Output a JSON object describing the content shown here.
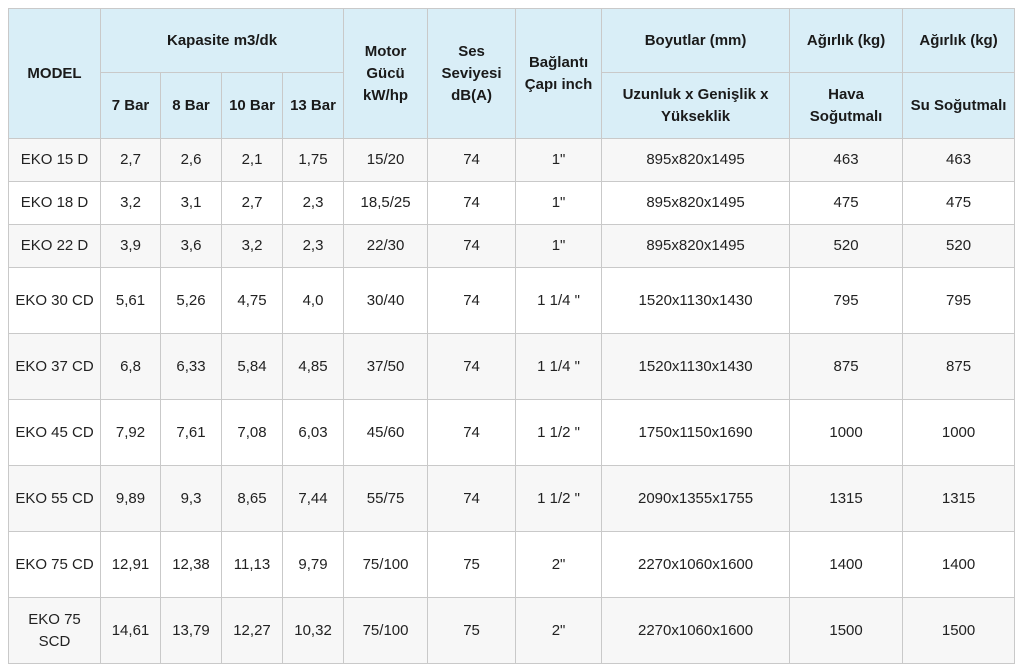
{
  "header": {
    "model": "MODEL",
    "capacity": "Kapasite m3/dk",
    "pressures": [
      "7 Bar",
      "8 Bar",
      "10 Bar",
      "13 Bar"
    ],
    "motor": "Motor Gücü kW/hp",
    "sound": "Ses Seviyesi dB(A)",
    "connection": "Bağlantı Çapı inch",
    "dimensions": "Boyutlar (mm)",
    "dimensions_sub": "Uzunluk x Genişlik x Yükseklik",
    "weight_air": "Ağırlık (kg)",
    "weight_air_sub": "Hava Soğutmalı",
    "weight_water": "Ağırlık (kg)",
    "weight_water_sub": "Su Soğutmalı"
  },
  "rows": [
    {
      "model": "EKO 15 D",
      "c7": "2,7",
      "c8": "2,6",
      "c10": "2,1",
      "c13": "1,75",
      "motor": "15/20",
      "sound": "74",
      "conn": "1\"",
      "dims": "895x820x1495",
      "w_air": "463",
      "w_water": "463"
    },
    {
      "model": "EKO 18 D",
      "c7": "3,2",
      "c8": "3,1",
      "c10": "2,7",
      "c13": "2,3",
      "motor": "18,5/25",
      "sound": "74",
      "conn": "1\"",
      "dims": "895x820x1495",
      "w_air": "475",
      "w_water": "475"
    },
    {
      "model": "EKO 22 D",
      "c7": "3,9",
      "c8": "3,6",
      "c10": "3,2",
      "c13": "2,3",
      "motor": "22/30",
      "sound": "74",
      "conn": "1\"",
      "dims": "895x820x1495",
      "w_air": "520",
      "w_water": "520"
    },
    {
      "model": "EKO 30 CD",
      "c7": "5,61",
      "c8": "5,26",
      "c10": "4,75",
      "c13": "4,0",
      "motor": "30/40",
      "sound": "74",
      "conn": "1 1/4 \"",
      "dims": "1520x1130x1430",
      "w_air": "795",
      "w_water": "795"
    },
    {
      "model": "EKO 37 CD",
      "c7": "6,8",
      "c8": "6,33",
      "c10": "5,84",
      "c13": "4,85",
      "motor": "37/50",
      "sound": "74",
      "conn": "1 1/4 \"",
      "dims": "1520x1130x1430",
      "w_air": "875",
      "w_water": "875"
    },
    {
      "model": "EKO 45 CD",
      "c7": "7,92",
      "c8": "7,61",
      "c10": "7,08",
      "c13": "6,03",
      "motor": "45/60",
      "sound": "74",
      "conn": "1 1/2 \"",
      "dims": "1750x1150x1690",
      "w_air": "1000",
      "w_water": "1000"
    },
    {
      "model": "EKO 55 CD",
      "c7": "9,89",
      "c8": "9,3",
      "c10": "8,65",
      "c13": "7,44",
      "motor": "55/75",
      "sound": "74",
      "conn": "1 1/2 \"",
      "dims": "2090x1355x1755",
      "w_air": "1315",
      "w_water": "1315"
    },
    {
      "model": "EKO 75 CD",
      "c7": "12,91",
      "c8": "12,38",
      "c10": "11,13",
      "c13": "9,79",
      "motor": "75/100",
      "sound": "75",
      "conn": "2\"",
      "dims": "2270x1060x1600",
      "w_air": "1400",
      "w_water": "1400"
    },
    {
      "model": "EKO 75 SCD",
      "c7": "14,61",
      "c8": "13,79",
      "c10": "12,27",
      "c13": "10,32",
      "motor": "75/100",
      "sound": "75",
      "conn": "2\"",
      "dims": "2270x1060x1600",
      "w_air": "1500",
      "w_water": "1500"
    }
  ],
  "colors": {
    "header_bg": "#d9eef7",
    "stripe_bg": "#f7f7f7",
    "border": "#c9c9c9"
  }
}
